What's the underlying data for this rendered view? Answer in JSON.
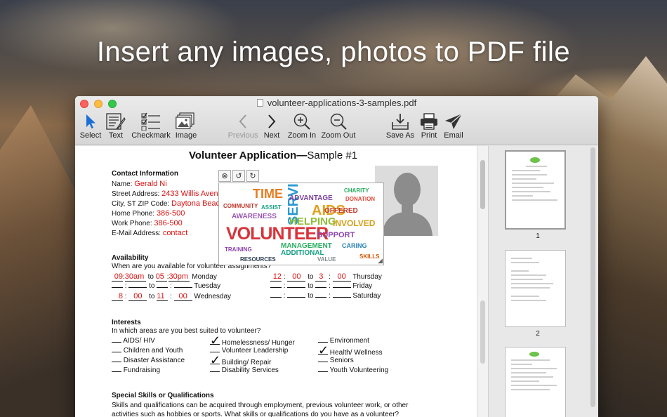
{
  "headline": "Insert any images, photos to PDF file",
  "window": {
    "title": "volunteer-applications-3-samples.pdf"
  },
  "toolbar": {
    "select": "Select",
    "text": "Text",
    "checkmark": "Checkmark",
    "image": "Image",
    "previous": "Previous",
    "next": "Next",
    "zoom_in": "Zoom In",
    "zoom_out": "Zoom Out",
    "save_as": "Save As",
    "print": "Print",
    "email": "Email"
  },
  "document": {
    "title_bold": "Volunteer Application—",
    "title_normal": "Sample #1",
    "contact_heading": "Contact Information",
    "name_label": "Name:",
    "name_value": "Gerald Ni",
    "street_label": "Street Address:",
    "street_value": "2433 Willis Avenue",
    "city_label": "City, ST ZIP Code:",
    "city_value": "Daytona Beach",
    "home_label": "Home Phone:",
    "home_value": "386-500",
    "work_label": "Work Phone:",
    "work_value": "386-500",
    "email_label": "E-Mail Address:",
    "email_value": "contact",
    "availability_heading": "Availability",
    "availability_question": "When are you available for volunteer assignments?",
    "to": "to",
    "days_left": [
      "Monday",
      "Tuesday",
      "Wednesday"
    ],
    "days_right": [
      "Thursday",
      "Friday",
      "Saturday"
    ],
    "mon": {
      "h1": "09",
      "m1": "30am",
      "h2": "05",
      "m2": "30pm"
    },
    "wed": {
      "h1": "8",
      "m1": "00",
      "h2": "11",
      "m2": "00"
    },
    "thu": {
      "h1": "12",
      "m1": "00",
      "h2": "3",
      "m2": "00"
    },
    "interests_heading": "Interests",
    "interests_question": "In which areas are you best suited to volunteer?",
    "interests_col1": [
      "AIDS/ HIV",
      "Children and Youth",
      "Disaster Assistance",
      "Fundraising"
    ],
    "interests_col2": [
      "Homelessness/ Hunger",
      "Volunteer Leadership",
      "Building/ Repair",
      "Disability Services"
    ],
    "interests_col3": [
      "Environment",
      "Health/ Wellness",
      "Seniors",
      "Youth Volunteering"
    ],
    "skills_heading": "Special Skills or Qualifications",
    "skills_text_1": "Skills and qualifications can be acquired through employment, previous volunteer work, or other",
    "skills_text_2": "activities such as hobbies or sports. What skills or qualifications do you have as a volunteer?"
  },
  "wordcloud": {
    "main": "VOLUNTEER",
    "words": [
      "SERVICES",
      "AIDS",
      "HELPING",
      "ADVANTAGE",
      "OFFERED",
      "INVOLVED",
      "SUPPORT",
      "AWARENESS",
      "MANAGEMENT",
      "ADDITIONAL",
      "TIME",
      "CARING",
      "COMMUNITY",
      "TRAINING",
      "CHARITY",
      "DONATION",
      "RESOURCES",
      "SKILLS",
      "ASSIST",
      "VALUE"
    ]
  },
  "thumbnails": {
    "labels": [
      "1",
      "2"
    ]
  }
}
